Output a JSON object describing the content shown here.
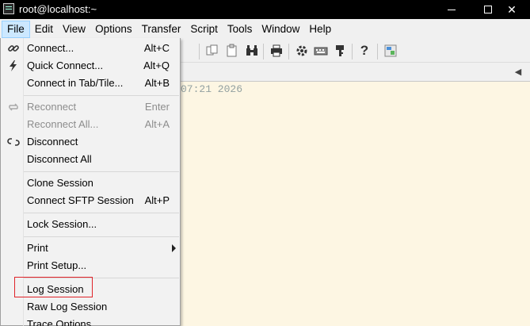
{
  "window": {
    "title": "root@localhost:~",
    "min_glyph": "",
    "max_glyph": "",
    "close_glyph": "✕"
  },
  "menubar": [
    {
      "label": "File",
      "active": true
    },
    {
      "label": "Edit"
    },
    {
      "label": "View"
    },
    {
      "label": "Options"
    },
    {
      "label": "Transfer"
    },
    {
      "label": "Script"
    },
    {
      "label": "Tools"
    },
    {
      "label": "Window"
    },
    {
      "label": "Help"
    }
  ],
  "toolbar": {
    "icons": [
      "copy-icon",
      "paste-icon",
      "find-icon",
      "print-icon",
      "settings-icon",
      "keymap-icon",
      "key-icon",
      "help-icon",
      "sftp-icon"
    ]
  },
  "terminal": {
    "visible_text": "07:21 2026"
  },
  "file_menu": {
    "items": [
      {
        "label": "Connect...",
        "accel": "Alt+C",
        "icon": "link-icon",
        "enabled": true
      },
      {
        "label": "Quick Connect...",
        "accel": "Alt+Q",
        "icon": "lightning-icon",
        "enabled": true
      },
      {
        "label": "Connect in Tab/Tile...",
        "accel": "Alt+B",
        "enabled": true
      },
      {
        "label": "Reconnect",
        "accel": "Enter",
        "icon": "reconnect-icon",
        "enabled": false
      },
      {
        "label": "Reconnect All...",
        "accel": "Alt+A",
        "enabled": false
      },
      {
        "label": "Disconnect",
        "accel": "",
        "icon": "broken-link-icon",
        "enabled": true
      },
      {
        "label": "Disconnect All",
        "accel": "",
        "enabled": true
      },
      {
        "label": "Clone Session",
        "accel": "",
        "enabled": true
      },
      {
        "label": "Connect SFTP Session",
        "accel": "Alt+P",
        "enabled": true
      },
      {
        "label": "Lock Session...",
        "accel": "",
        "enabled": true
      },
      {
        "label": "Print",
        "accel": "",
        "submenu": true,
        "enabled": true
      },
      {
        "label": "Print Setup...",
        "accel": "",
        "enabled": true
      },
      {
        "label": "Log Session",
        "accel": "",
        "enabled": true,
        "highlighted": true
      },
      {
        "label": "Raw Log Session",
        "accel": "",
        "enabled": true
      },
      {
        "label": "Trace Options",
        "accel": "",
        "enabled": true
      }
    ]
  },
  "colors": {
    "titlebar": "#000000",
    "menubar": "#f0f0f0",
    "terminal_bg": "#fdf6e3",
    "highlight_border": "#e0242a",
    "active_menu": "#cce8ff"
  }
}
